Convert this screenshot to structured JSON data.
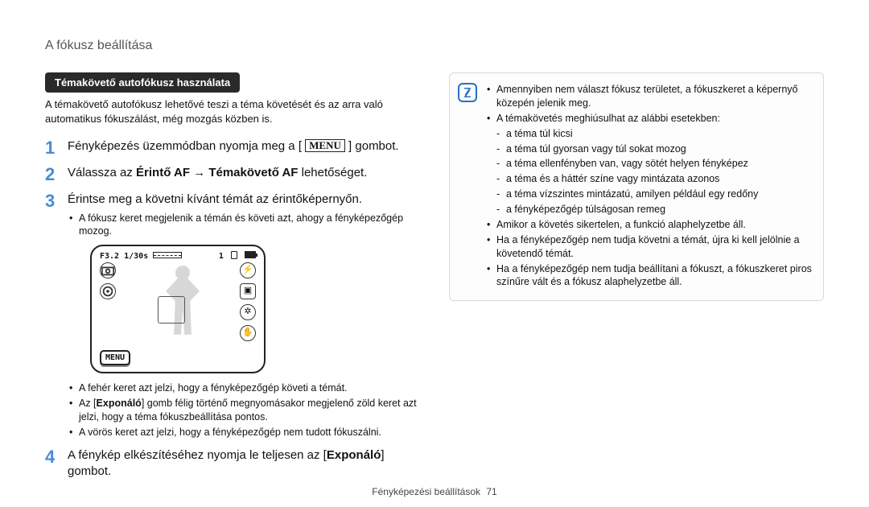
{
  "header": {
    "title": "A fókusz beállítása"
  },
  "left": {
    "section_title": "Témakövető autofókusz használata",
    "intro": "A témakövető autofókusz lehetővé teszi a téma követését és az arra való automatikus fókuszálást, még mozgás közben is.",
    "steps": {
      "s1_a": "Fényképezés üzemmódban nyomja meg a [",
      "s1_menu": "MENU",
      "s1_b": "] gombot.",
      "s2_a": "Válassza az ",
      "s2_b": "Érintő AF",
      "s2_c": " → ",
      "s2_d": "Témakövető AF",
      "s2_e": " lehetőséget.",
      "s3": "Érintse meg a követni kívánt témát az érintőképernyőn.",
      "s3_sub": "A fókusz keret megjelenik a témán és követi azt, ahogy a fényképezőgép mozog.",
      "after_bullets": [
        "A fehér keret azt jelzi, hogy a fényképezőgép követi a témát.",
        "Az [Exponáló] gomb félig történő megnyomásakor megjelenő zöld keret azt jelzi, hogy a téma fókuszbeállítása pontos.",
        "A vörös keret azt jelzi, hogy a fényképezőgép nem tudott fókuszálni."
      ],
      "s4_a": "A fénykép elkészítéséhez nyomja le teljesen az [",
      "s4_b": "Exponáló",
      "s4_c": "] gombot."
    },
    "lcd": {
      "aperture": "F3.2",
      "shutter": "1/30s",
      "shots": "1",
      "menu_label": "MENU"
    }
  },
  "right": {
    "items": [
      {
        "lvl": 1,
        "text": "Amennyiben nem választ fókusz területet, a fókuszkeret a képernyő közepén jelenik meg."
      },
      {
        "lvl": 1,
        "text": "A témakövetés meghiúsulhat az alábbi esetekben:"
      },
      {
        "lvl": 2,
        "text": "a téma túl kicsi"
      },
      {
        "lvl": 2,
        "text": "a téma túl gyorsan vagy túl sokat mozog"
      },
      {
        "lvl": 2,
        "text": "a téma ellenfényben van, vagy sötét helyen fényképez"
      },
      {
        "lvl": 2,
        "text": "a téma és a háttér színe vagy mintázata azonos"
      },
      {
        "lvl": 2,
        "text": "a téma vízszintes mintázatú, amilyen például egy redőny"
      },
      {
        "lvl": 2,
        "text": "a fényképezőgép túlságosan remeg"
      },
      {
        "lvl": 1,
        "text": "Amikor a követés sikertelen, a funkció alaphelyzetbe áll."
      },
      {
        "lvl": 1,
        "text": "Ha a fényképezőgép nem tudja követni a témát, újra ki kell jelölnie a követendő témát."
      },
      {
        "lvl": 1,
        "text": "Ha a fényképezőgép nem tudja beállítani a fókuszt, a fókuszkeret piros színűre vált és a fókusz alaphelyzetbe áll."
      }
    ]
  },
  "footer": {
    "section": "Fényképezési beállítások",
    "page": "71"
  }
}
